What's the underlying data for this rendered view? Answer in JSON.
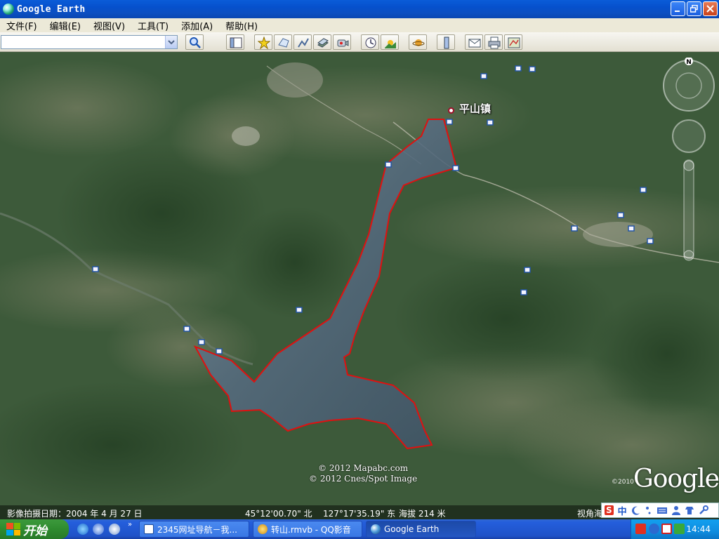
{
  "window": {
    "title": "Google Earth",
    "controls": [
      "minimize-icon",
      "restore-icon",
      "close-icon"
    ]
  },
  "menu": [
    "文件(F)",
    "编辑(E)",
    "视图(V)",
    "工具(T)",
    "添加(A)",
    "帮助(H)"
  ],
  "toolbar": {
    "search_value": "",
    "buttons": [
      "search-icon",
      "sidebar-icon",
      "placemark-icon",
      "polygon-icon",
      "path-icon",
      "overlay-icon",
      "record-tour-icon",
      "historical-imagery-icon",
      "sunlight-icon",
      "planets-icon",
      "ruler-icon",
      "email-icon",
      "print-icon",
      "view-in-maps-icon"
    ]
  },
  "map": {
    "place_label": "平山镇",
    "copyright_1": "© 2012 Mapabc.com",
    "copyright_2": "© 2012 Cnes/Spot Image",
    "google_year": "©2010",
    "google_logo": "Google",
    "outline_color": "#e01010",
    "compass_north": "N"
  },
  "status": {
    "imagery_date": "影像拍摄日期：2004 年 4 月 27 日",
    "latitude": "45°12'00.70\" 北",
    "longitude": "127°17'35.19\" 东",
    "elevation": "海拔  214 米",
    "eye_alt": "视角海"
  },
  "ime": {
    "brand": "S",
    "mode": "中"
  },
  "taskbar": {
    "start_label": "开始",
    "tasks": [
      {
        "label": "2345网址导航－我...",
        "icon": "ie-page-icon"
      },
      {
        "label": "转山.rmvb - QQ影音",
        "icon": "qq-player-icon"
      },
      {
        "label": "Google Earth",
        "icon": "google-earth-icon"
      }
    ],
    "clock": "14:44"
  }
}
